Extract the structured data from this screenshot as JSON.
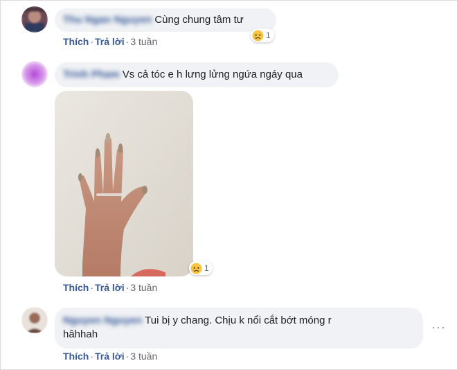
{
  "comments": [
    {
      "author": "Thu Ngan Nguyen",
      "text": "Cùng chung tâm tư",
      "reaction_count": "1",
      "actions": {
        "like": "Thích",
        "reply": "Trả lời",
        "time": "3 tuần"
      }
    },
    {
      "author": "Trinh Pham",
      "text": "Vs cả tóc e h lưng lửng ngứa ngáy qua",
      "reaction_count": "1",
      "actions": {
        "like": "Thích",
        "reply": "Trả lời",
        "time": "3 tuần"
      }
    },
    {
      "author": "Nguyen Nguyen",
      "text_line1": "Tui bị y chang. Chịu k nổi cắt bớt móng r",
      "text_line2": "hâhhah",
      "more": "···",
      "actions": {
        "like": "Thích",
        "reply": "Trả lời",
        "time": "3 tuần"
      }
    }
  ],
  "colors": {
    "link": "#365899",
    "bubble": "#f0f2f5",
    "meta": "#616770"
  },
  "icons": [
    "sad-reaction-icon",
    "more-options-icon"
  ]
}
